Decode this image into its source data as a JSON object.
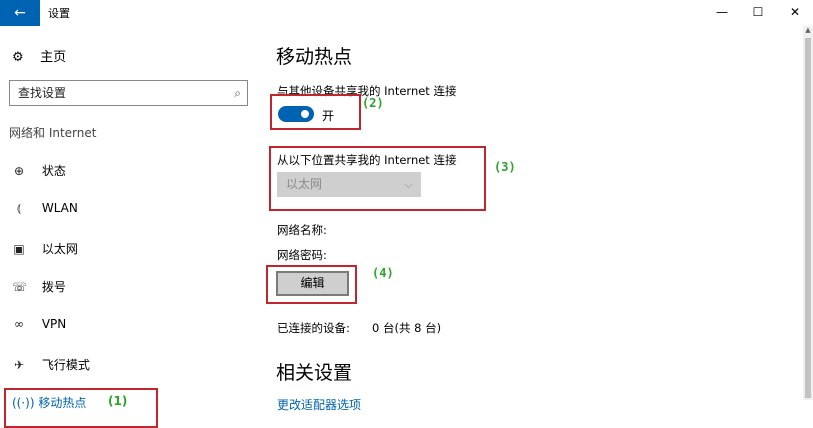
{
  "window": {
    "title": "设置",
    "back_icon": "←",
    "minimize_icon": "—",
    "maximize_icon": "☐",
    "close_icon": "✕"
  },
  "sidebar": {
    "home": {
      "label": "主页",
      "icon": "⚙"
    },
    "search": {
      "placeholder": "查找设置",
      "icon": "⌕"
    },
    "section": "网络和 Internet",
    "items": [
      {
        "label": "状态",
        "icon": "⊕"
      },
      {
        "label": "WLAN",
        "icon": "⦅"
      },
      {
        "label": "以太网",
        "icon": "▣"
      },
      {
        "label": "拨号",
        "icon": "☏"
      },
      {
        "label": "VPN",
        "icon": "∞"
      },
      {
        "label": "飞行模式",
        "icon": "✈"
      }
    ],
    "active": {
      "label": "移动热点",
      "icon": "((·))",
      "marker": "(1)"
    }
  },
  "main": {
    "title": "移动热点",
    "share_label": "与其他设备共享我的 Internet 连接",
    "toggle": {
      "state_label": "开",
      "on": true,
      "marker": "(2)"
    },
    "share_from": {
      "label": "从以下位置共享我的 Internet 连接",
      "selected": "以太网",
      "marker": "(3)"
    },
    "network_name_label": "网络名称:",
    "network_password_label": "网络密码:",
    "edit": {
      "label": "编辑",
      "marker": "(4)"
    },
    "connected": {
      "label": "已连接的设备:",
      "value": "0 台(共 8 台)"
    },
    "related_title": "相关设置",
    "related_link": "更改适配器选项"
  },
  "colors": {
    "accent": "#0063b1",
    "highlight_box": "#c0262d",
    "marker_text": "#2aa52a"
  }
}
